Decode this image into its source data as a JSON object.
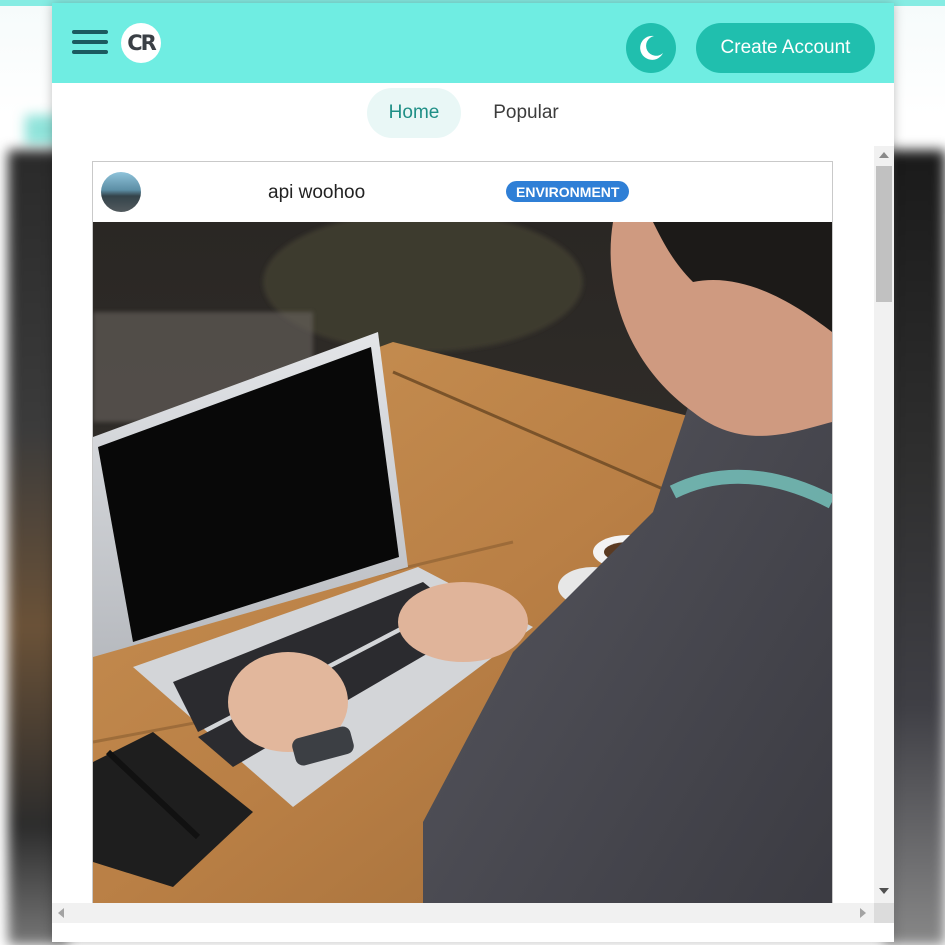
{
  "header": {
    "logo_text": "CR",
    "create_account_label": "Create Account",
    "brand_color": "#6fede2",
    "accent_color": "#20bfae"
  },
  "icons": {
    "menu": "hamburger-menu-icon",
    "theme": "moon-icon"
  },
  "tabs": [
    {
      "label": "Home",
      "active": true
    },
    {
      "label": "Popular",
      "active": false
    }
  ],
  "post": {
    "author": "api woohoo",
    "category": "ENVIRONMENT",
    "category_color": "#2f7fd6",
    "image_subject": "person typing on a laptop at a wooden table"
  }
}
